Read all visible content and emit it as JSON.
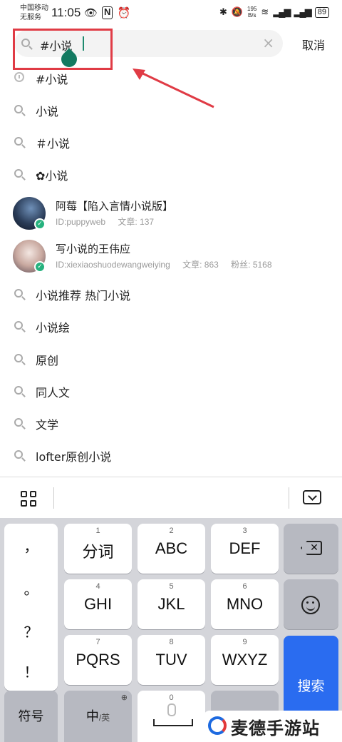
{
  "status_bar": {
    "carrier_line1": "中国移动",
    "carrier_line2": "无服务",
    "time": "11:05",
    "speed_value": "195",
    "speed_unit": "B/s",
    "battery": "89"
  },
  "search": {
    "query": "#小说",
    "cancel_label": "取消",
    "clear_icon": "×"
  },
  "suggestions_top": [
    {
      "label": "#小说",
      "icon": "history-clock-icon"
    },
    {
      "label": "小说",
      "icon": "search-icon"
    },
    {
      "label": "＃小说",
      "icon": "search-icon"
    },
    {
      "label": "✿小说",
      "icon": "search-icon"
    }
  ],
  "users": [
    {
      "name": "阿莓【陷入言情小说版】",
      "id": "ID:puppyweb",
      "articles": "文章: 137",
      "fans": ""
    },
    {
      "name": "写小说的王伟应",
      "id": "ID:xiexiaoshuodewangweiying",
      "articles": "文章: 863",
      "fans": "粉丝: 5168"
    }
  ],
  "suggestions_bottom": [
    {
      "label": "小说推荐 热门小说"
    },
    {
      "label": "小说绘"
    },
    {
      "label": "原创"
    },
    {
      "label": "同人文"
    },
    {
      "label": "文学"
    },
    {
      "label": "lofter原创小说"
    }
  ],
  "keyboard": {
    "punctuation": [
      "，",
      "。",
      "？",
      "！"
    ],
    "keys": [
      {
        "num": "1",
        "main": "分词"
      },
      {
        "num": "2",
        "main": "ABC"
      },
      {
        "num": "3",
        "main": "DEF"
      },
      {
        "num": "4",
        "main": "GHI"
      },
      {
        "num": "5",
        "main": "JKL"
      },
      {
        "num": "6",
        "main": "MNO"
      },
      {
        "num": "7",
        "main": "PQRS"
      },
      {
        "num": "8",
        "main": "TUV"
      },
      {
        "num": "9",
        "main": "WXYZ"
      }
    ],
    "symbol_label": "符号",
    "lang_main": "中",
    "lang_sub": "/英",
    "zero": "0",
    "search_label": "搜索"
  },
  "watermark": {
    "text": "麦德手游站"
  },
  "colors": {
    "accent": "#2a6cf0",
    "highlight_box": "#e03b45",
    "caret": "#1e8a6e",
    "verified": "#26b27e"
  }
}
